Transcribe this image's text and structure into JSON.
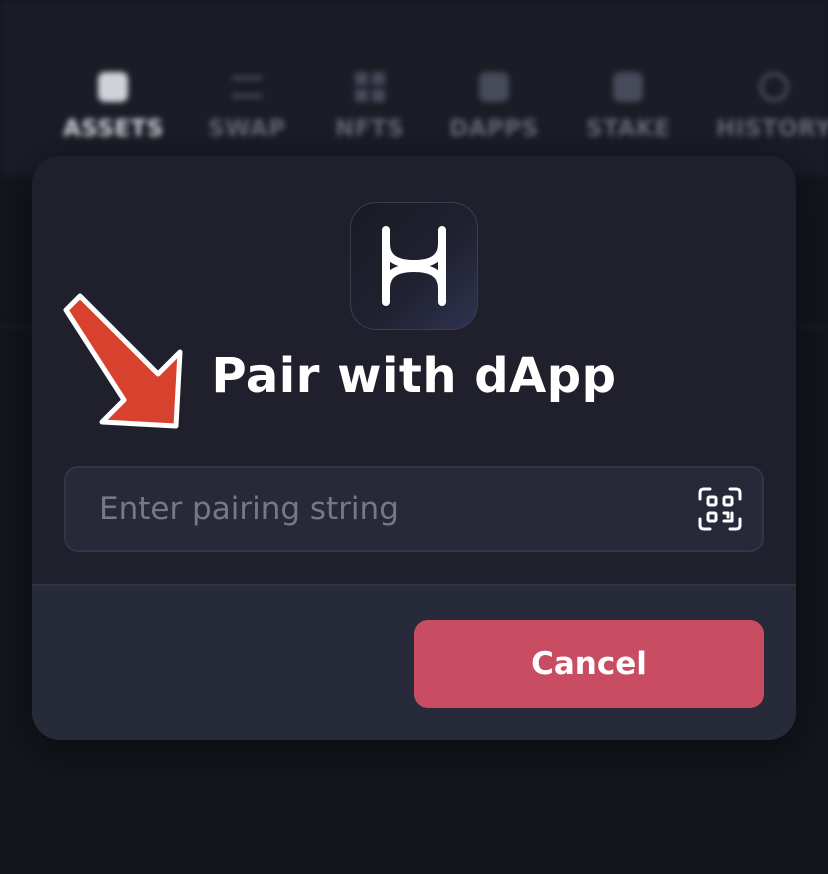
{
  "background_nav": {
    "items": [
      {
        "label": "ASSETS",
        "icon": "wallet-icon",
        "active": true
      },
      {
        "label": "SWAP",
        "icon": "swap-arrows-icon",
        "active": false
      },
      {
        "label": "NFTS",
        "icon": "grid-icon",
        "active": false
      },
      {
        "label": "DAPPS",
        "icon": "browser-icon",
        "active": false
      },
      {
        "label": "STAKE",
        "icon": "stake-icon",
        "active": false
      },
      {
        "label": "HISTORY",
        "icon": "history-clock-icon",
        "active": false
      }
    ]
  },
  "modal": {
    "title": "Pair with dApp",
    "logo_icon": "hashpack-h-logo-icon",
    "input": {
      "placeholder": "Enter pairing string",
      "value": ""
    },
    "qr_icon": "qr-code-scan-icon",
    "cancel_label": "Cancel"
  },
  "annotation": {
    "arrow_icon": "red-arrow-icon",
    "arrow_color": "#d9412f"
  },
  "colors": {
    "accent_cancel": "#c84d62",
    "modal_bg": "#20202c",
    "page_bg": "#14151d"
  }
}
